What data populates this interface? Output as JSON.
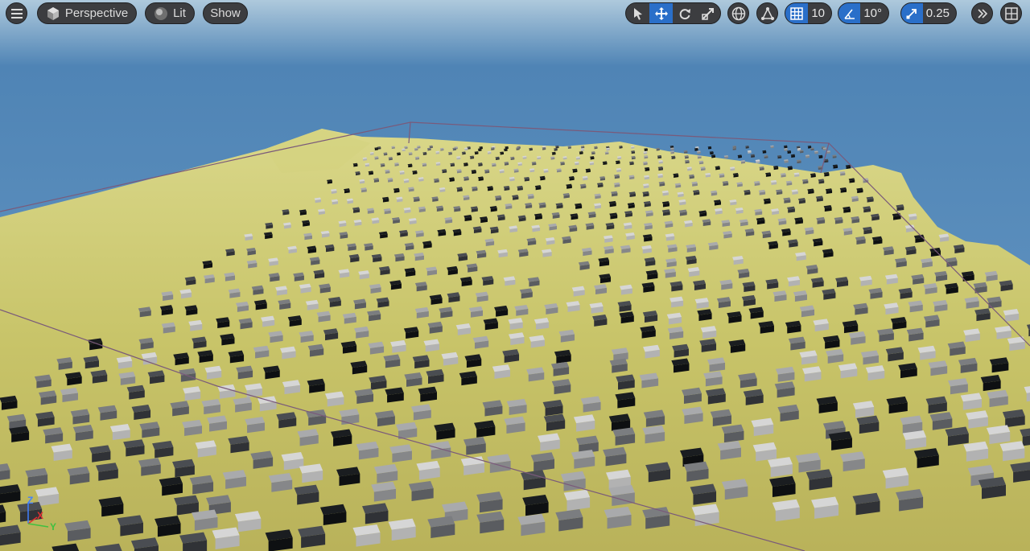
{
  "toolbar": {
    "menu_icon": "hamburger-icon",
    "view_mode": "Perspective",
    "view_mode_icon": "cube-icon",
    "lighting": "Lit",
    "lighting_icon": "sphere-icon",
    "show_label": "Show",
    "transform_tools": [
      "select-icon",
      "translate-icon",
      "rotate-icon",
      "scale-icon"
    ],
    "active_tool": "translate",
    "grid_snap_value": "10",
    "rotation_snap_value": "10°",
    "scale_snap_value": "0.25"
  },
  "axis_labels": {
    "z": "Z",
    "x": "X",
    "y": "Y"
  },
  "colors": {
    "sky": "#4c7fb0",
    "terrain": "#c9c96a",
    "accent_active": "#2a6fc9",
    "toolbar_bg": "#3c3d40",
    "volume_outline": "#7a5a7a",
    "axis_x": "#e03030",
    "axis_y": "#40c040",
    "axis_z": "#4080ff"
  }
}
